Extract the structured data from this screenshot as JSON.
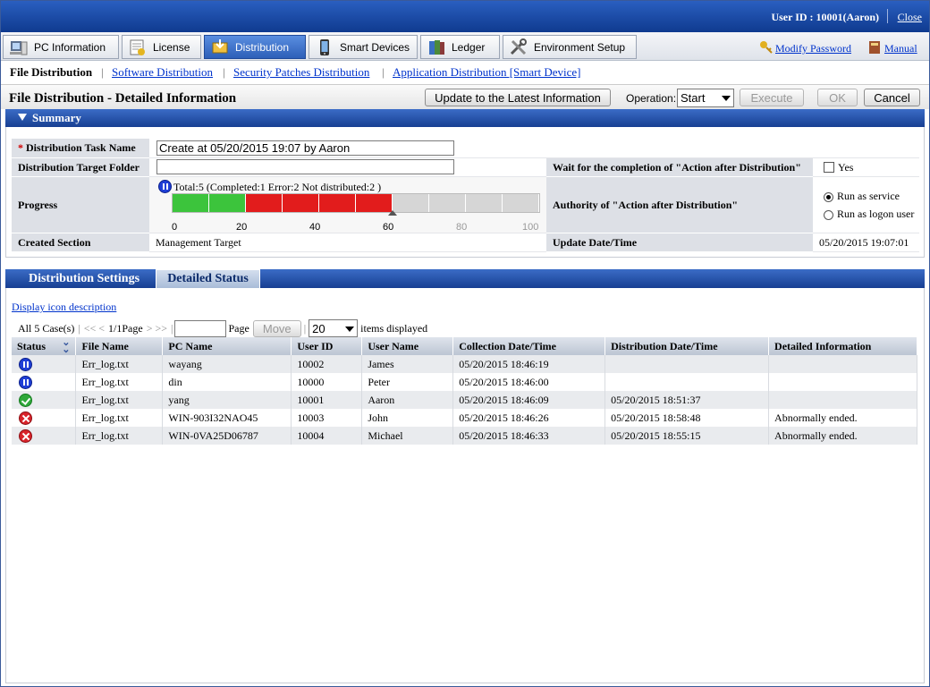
{
  "topbar": {
    "user_id": "User ID : 10001(Aaron)",
    "close": "Close"
  },
  "nav": {
    "tabs": [
      {
        "label": "PC Information",
        "icon": "pc-icon"
      },
      {
        "label": "License",
        "icon": "license-icon"
      },
      {
        "label": "Distribution",
        "icon": "distribution-icon",
        "active": true
      },
      {
        "label": "Smart Devices",
        "icon": "smartphone-icon"
      },
      {
        "label": "Ledger",
        "icon": "ledger-icon"
      },
      {
        "label": "Environment Setup",
        "icon": "tools-icon"
      }
    ],
    "modify_password": "Modify Password",
    "manual": "Manual"
  },
  "subnav": {
    "current": "File Distribution",
    "links": [
      "Software Distribution",
      "Security Patches Distribution",
      "Application Distribution [Smart Device]"
    ]
  },
  "header": {
    "title": "File Distribution - Detailed Information",
    "update_button": "Update to the Latest Information",
    "operation_label": "Operation:",
    "operation_value": "Start",
    "execute": "Execute",
    "ok": "OK",
    "cancel": "Cancel"
  },
  "summary": {
    "title": "Summary",
    "required_mark": "*",
    "task_name_label": "Distribution Task Name",
    "task_name_value": "Create at 05/20/2015 19:07 by Aaron",
    "target_folder_label": "Distribution Target Folder",
    "target_folder_value": "",
    "wait_label": "Wait for the completion of \"Action after Distribution\"",
    "wait_option": "Yes",
    "progress_label": "Progress",
    "progress_text": "Total:5  (Completed:1  Error:2  Not distributed:2 )",
    "progress": {
      "total": 5,
      "completed": 1,
      "error": 2,
      "not_distributed": 2,
      "ticks": [
        "0",
        "20",
        "40",
        "60",
        "80",
        "100"
      ]
    },
    "authority_label": "Authority of \"Action after Distribution\"",
    "authority_options": [
      "Run as service",
      "Run as logon user"
    ],
    "created_section_label": "Created Section",
    "created_section_value": "Management Target",
    "update_label": "Update Date/Time",
    "update_value": "05/20/2015 19:07:01",
    "colors": {
      "completed": "#3cc43c",
      "error": "#e21c1c",
      "remaining": "#d6d6d6"
    }
  },
  "detail_tabs": [
    "Distribution Settings",
    "Detailed Status"
  ],
  "details": {
    "icon_desc_link": "Display icon description",
    "pager": {
      "count": "All 5 Case(s)",
      "first_prev": "<< <",
      "page_info": "1/1Page",
      "next_last": "> >>",
      "page_label": "Page",
      "move": "Move",
      "per_page": "20",
      "items_label": "items displayed"
    },
    "columns": [
      "Status",
      "File Name",
      "PC Name",
      "User ID",
      "User Name",
      "Collection Date/Time",
      "Distribution Date/Time",
      "Detailed Information"
    ],
    "rows": [
      {
        "status": "not-distributed",
        "file": "Err_log.txt",
        "pc": "wayang",
        "uid": "10002",
        "user": "James",
        "collection": "05/20/2015 18:46:19",
        "distribution": "",
        "detail": ""
      },
      {
        "status": "not-distributed",
        "file": "Err_log.txt",
        "pc": "din",
        "uid": "10000",
        "user": "Peter",
        "collection": "05/20/2015 18:46:00",
        "distribution": "",
        "detail": ""
      },
      {
        "status": "completed",
        "file": "Err_log.txt",
        "pc": "yang",
        "uid": "10001",
        "user": "Aaron",
        "collection": "05/20/2015 18:46:09",
        "distribution": "05/20/2015 18:51:37",
        "detail": ""
      },
      {
        "status": "error",
        "file": "Err_log.txt",
        "pc": "WIN-903I32NAO45",
        "uid": "10003",
        "user": "John",
        "collection": "05/20/2015 18:46:26",
        "distribution": "05/20/2015 18:58:48",
        "detail": "Abnormally ended."
      },
      {
        "status": "error",
        "file": "Err_log.txt",
        "pc": "WIN-0VA25D06787",
        "uid": "10004",
        "user": "Michael",
        "collection": "05/20/2015 18:46:33",
        "distribution": "05/20/2015 18:55:15",
        "detail": "Abnormally ended."
      }
    ]
  }
}
